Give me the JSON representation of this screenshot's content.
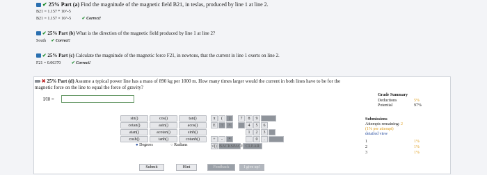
{
  "part_a": {
    "heading_prefix": "25%",
    "heading_label": "Part (a)",
    "question": "Find the magnitude of the magnetic field B21, in teslas, produced by line 1 at line 2.",
    "answer_line1": "B21 = 1.157 * 10^-5",
    "answer_line2": "B21 = 1.157 × 10^-5",
    "correct_label": "Correct!"
  },
  "part_b": {
    "heading_prefix": "25%",
    "heading_label": "Part (b)",
    "question": "What is the direction of the magnetic field produced by line 1 at line 2?",
    "answer": "South",
    "correct_label": "Correct!"
  },
  "part_c": {
    "heading_prefix": "25%",
    "heading_label": "Part (c)",
    "question": "Calculate the magnitude of the magnetic force F21, in newtons, that the current in line 1 exerts on line 2.",
    "answer": "F21 = 0.06370",
    "correct_label": "Correct!"
  },
  "part_d": {
    "heading_prefix": "25%",
    "heading_label": "Part (d)",
    "question_line1": "Assume a typical power line has a mass of 890 kg per 1000 m. How many times larger would the current in both lines have to be for the",
    "question_line2": "magnetic force on the line to equal the force of gravity?",
    "input_label": "I/I0 =",
    "input_value": ""
  },
  "calculator": {
    "functions": [
      [
        "sin()",
        "cos()",
        "tan()"
      ],
      [
        "cotan()",
        "asin()",
        "acos()"
      ],
      [
        "atan()",
        "acotan()",
        "sinh()"
      ],
      [
        "cosh()",
        "tanh()",
        "cotanh()"
      ]
    ],
    "symbols": [
      "π",
      "(",
      ")",
      "E",
      "↑",
      "^",
      "+",
      "-",
      "*",
      "√()",
      "BACKSPACE",
      "CLEAR"
    ],
    "digits": [
      [
        "7",
        "8",
        "9"
      ],
      [
        "4",
        "5",
        "6"
      ],
      [
        "1",
        "2",
        "3"
      ],
      [
        "",
        "0",
        "."
      ]
    ],
    "degrees_label": "Degrees",
    "radians_label": "Radians",
    "mode_selected": "Degrees"
  },
  "buttons": {
    "submit": "Submit",
    "hint": "Hint",
    "feedback": "Feedback",
    "give_up": "I give up!"
  },
  "grade_summary": {
    "title": "Grade Summary",
    "deductions_label": "Deductions",
    "deductions_value": "5%",
    "potential_label": "Potential",
    "potential_value": "97%",
    "submissions_title": "Submissions",
    "attempts_label": "Attempts remaining:",
    "attempts_value": "2",
    "per_attempt": "(1% per attempt)",
    "detailed_view": "detailed view",
    "rows": [
      {
        "n": "1",
        "pct": "1%"
      },
      {
        "n": "2",
        "pct": "1%"
      },
      {
        "n": "3",
        "pct": "1%"
      }
    ]
  },
  "colors": {
    "accent_blue": "#2a6fb0",
    "check_green": "#1a8a2a",
    "orange": "#e0a020"
  }
}
